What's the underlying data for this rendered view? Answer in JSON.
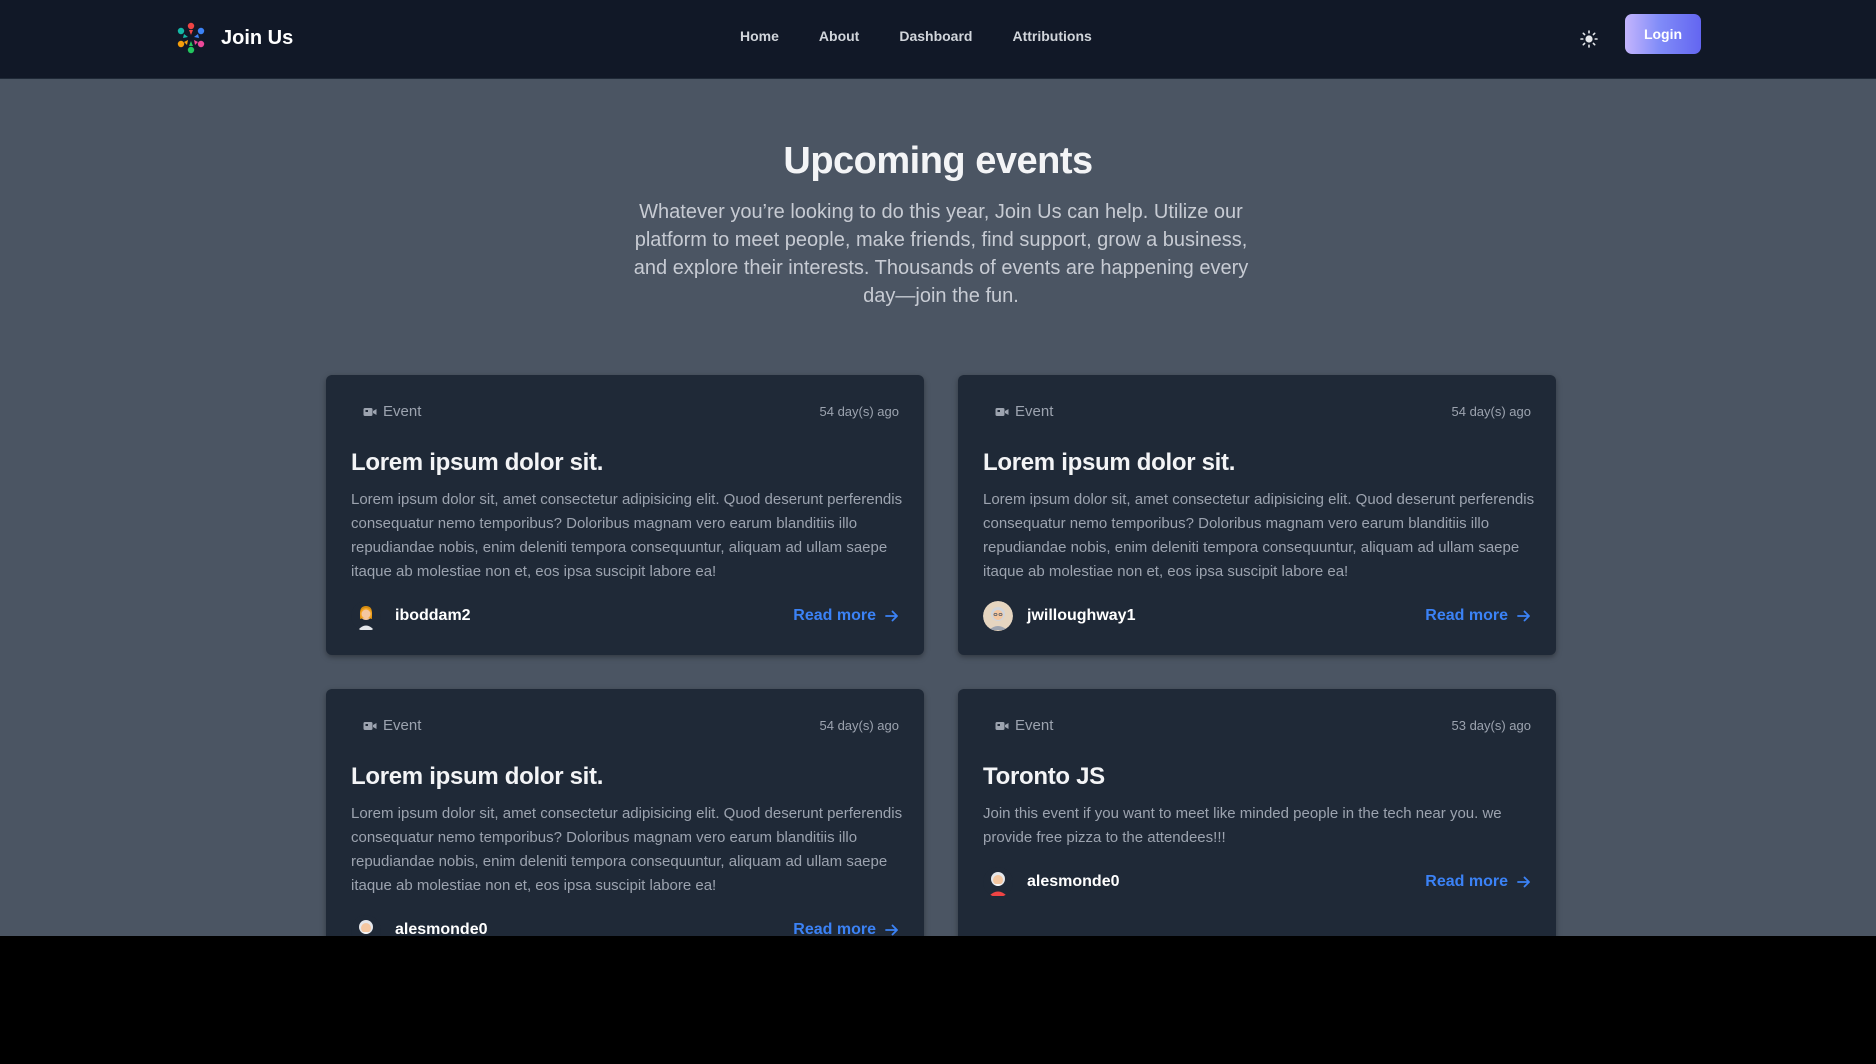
{
  "nav": {
    "brand": "Join Us",
    "links": [
      "Home",
      "About",
      "Dashboard",
      "Attributions"
    ],
    "login_label": "Login",
    "theme_icon": "sun-icon"
  },
  "hero": {
    "title": "Upcoming events",
    "subtitle": "Whatever you’re looking to do this year, Join Us can help. Utilize our platform to meet people, make friends, find support, grow a business, and explore their interests. Thousands of events are happening every day—join the fun."
  },
  "cards": [
    {
      "badge": "Event",
      "date": "54 day(s) ago",
      "title": "Lorem ipsum dolor sit.",
      "description": "Lorem ipsum dolor sit, amet consectetur adipisicing elit. Quod deserunt perferendis consequatur nemo temporibus? Doloribus magnam vero earum blanditiis illo repudiandae nobis, enim deleniti tempora consequuntur, aliquam ad ullam saepe itaque ab molestiae non et, eos ipsa suscipit labore ea!",
      "author": "iboddam2",
      "read_more": "Read more"
    },
    {
      "badge": "Event",
      "date": "54 day(s) ago",
      "title": "Lorem ipsum dolor sit.",
      "description": "Lorem ipsum dolor sit, amet consectetur adipisicing elit. Quod deserunt perferendis consequatur nemo temporibus? Doloribus magnam vero earum blanditiis illo repudiandae nobis, enim deleniti tempora consequuntur, aliquam ad ullam saepe itaque ab molestiae non et, eos ipsa suscipit labore ea!",
      "author": "jwilloughway1",
      "read_more": "Read more"
    },
    {
      "badge": "Event",
      "date": "54 day(s) ago",
      "title": "Lorem ipsum dolor sit.",
      "description": "Lorem ipsum dolor sit, amet consectetur adipisicing elit. Quod deserunt perferendis consequatur nemo temporibus? Doloribus magnam vero earum blanditiis illo repudiandae nobis, enim deleniti tempora consequuntur, aliquam ad ullam saepe itaque ab molestiae non et, eos ipsa suscipit labore ea!",
      "author": "alesmonde0",
      "read_more": "Read more"
    },
    {
      "badge": "Event",
      "date": "53 day(s) ago",
      "title": "Toronto JS",
      "description": "Join this event if you want to meet like minded people in the tech near you. we provide free pizza to the attendees!!!",
      "author": "alesmonde0",
      "read_more": "Read more"
    }
  ],
  "colors": {
    "navbar_bg": "#111827",
    "page_bg": "#4b5563",
    "card_bg": "#1f2937",
    "link_blue": "#3b82f6",
    "login_gradient_start": "#c4b5fd",
    "login_gradient_end": "#6366f1"
  }
}
